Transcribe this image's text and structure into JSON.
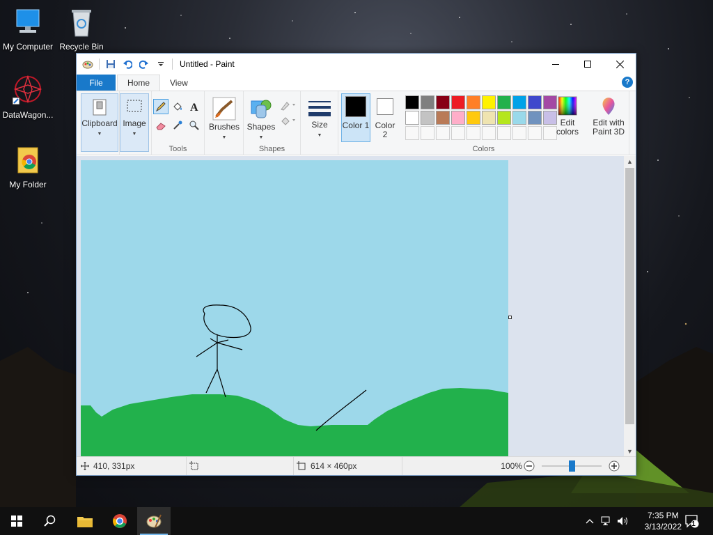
{
  "desktop": {
    "icons": [
      {
        "label": "My Computer"
      },
      {
        "label": "Recycle Bin"
      },
      {
        "label": "DataWagon..."
      },
      {
        "label": "My Folder"
      }
    ]
  },
  "window": {
    "title": "Untitled - Paint",
    "tabs": {
      "file": "File",
      "home": "Home",
      "view": "View"
    },
    "help": "?"
  },
  "ribbon": {
    "clipboard": "Clipboard",
    "image": "Image",
    "tools_label": "Tools",
    "brushes": "Brushes",
    "shapes": "Shapes",
    "shapes_label": "Shapes",
    "size": "Size",
    "color1_a": "Color",
    "color1_b": "1",
    "color2_a": "Color",
    "color2_b": "2",
    "edit_colors_a": "Edit",
    "edit_colors_b": "colors",
    "colors_label": "Colors",
    "paint3d_a": "Edit with",
    "paint3d_b": "Paint 3D",
    "color1_value": "#000000",
    "color2_value": "#ffffff",
    "palette_row1": [
      "#000000",
      "#7f7f7f",
      "#880015",
      "#ed1c24",
      "#ff7f27",
      "#fff200",
      "#22b14c",
      "#00a2e8",
      "#3f48cc",
      "#a349a4"
    ],
    "palette_row2": [
      "#ffffff",
      "#c3c3c3",
      "#b97a57",
      "#ffaec9",
      "#ffc90e",
      "#efe4b0",
      "#b5e61d",
      "#99d9ea",
      "#7092be",
      "#c8bfe7"
    ]
  },
  "canvas": {
    "sky_color": "#9dd8ea",
    "grass_color": "#22b14c",
    "stroke_color": "#000000"
  },
  "status": {
    "cursor": "410, 331px",
    "size": "614 × 460px",
    "zoom": "100%",
    "zoom_slider_percent": 50
  },
  "taskbar": {
    "time": "7:35 PM",
    "date": "3/13/2022",
    "notifications": "1"
  }
}
